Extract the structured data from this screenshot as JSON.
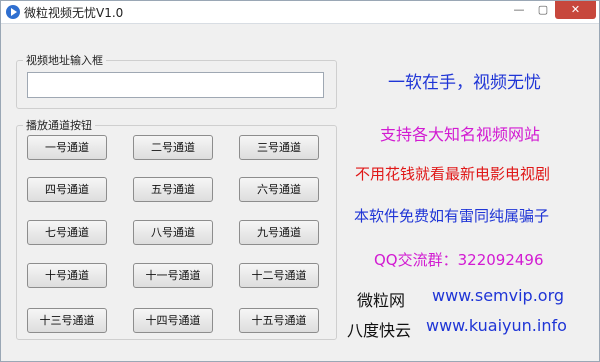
{
  "window": {
    "title": "微粒视频无忧V1.0",
    "minimize_glyph": "—",
    "maximize_glyph": "▢",
    "close_glyph": "✕",
    "icon": "play-circle-icon"
  },
  "url_group": {
    "legend": "视频地址输入框",
    "input_value": ""
  },
  "channels_group": {
    "legend": "播放通道按钮",
    "buttons": [
      "一号通道",
      "二号通道",
      "三号通道",
      "四号通道",
      "五号通道",
      "六号通道",
      "七号通道",
      "八号通道",
      "九号通道",
      "十号通道",
      "十一号通道",
      "十二号通道",
      "十三号通道",
      "十四号通道",
      "十五号通道"
    ]
  },
  "promo": {
    "line1": "一软在手，视频无忧",
    "line2": "支持各大知名视频网站",
    "line3": "不用花钱就看最新电影电视剧",
    "line4": "本软件免费如有雷同纯属骗子",
    "qq": "QQ交流群：322092496",
    "site1_name": "微粒网",
    "site1_url": "www.semvip.org",
    "site2_name": "八度快云",
    "site2_url": "www.kuaiyun.info"
  },
  "colors": {
    "blue": "#1f35d6",
    "magenta": "#d21bd2",
    "red": "#e01818",
    "black": "#111111",
    "close_red": "#c7473c"
  }
}
